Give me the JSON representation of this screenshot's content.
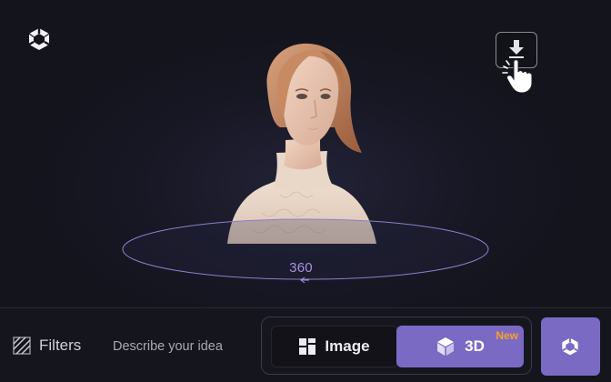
{
  "app": {
    "logo_icon": "cube-logo-icon"
  },
  "viewer": {
    "rotation_label": "360",
    "download_icon": "download-icon",
    "cursor_icon": "hand-pointer-icon",
    "subject": "portrait-3d-model"
  },
  "toolbar": {
    "filters_label": "Filters",
    "filters_icon": "stripes-icon",
    "prompt_placeholder": "Describe your idea",
    "modes": [
      {
        "label": "Image",
        "icon": "grid-icon",
        "selected": false
      },
      {
        "label": "3D",
        "icon": "cube-icon",
        "selected": true,
        "badge": "New"
      }
    ],
    "generate_icon": "cube-logo-icon"
  },
  "colors": {
    "accent": "#7b6ac4",
    "badge": "#f7a02a",
    "rotation_label": "#a493e0",
    "background": "#14141d"
  }
}
